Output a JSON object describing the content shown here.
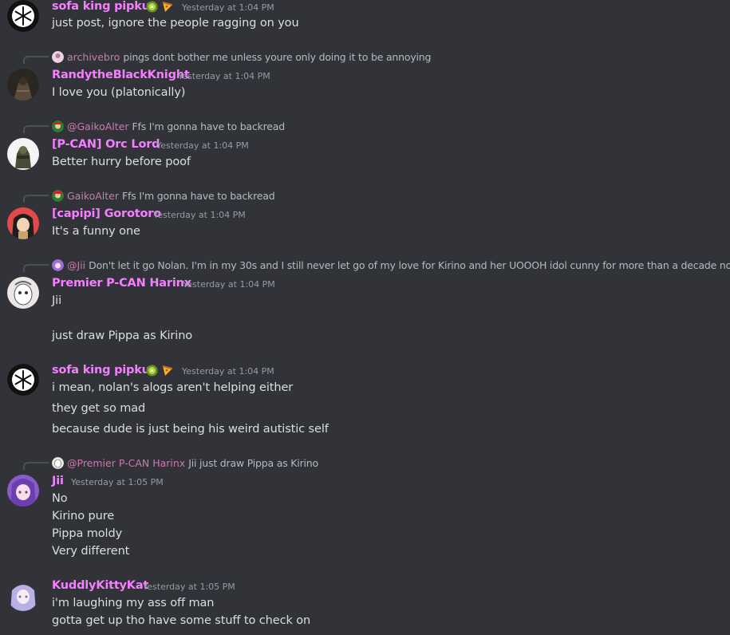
{
  "messages": [
    {
      "name": "sofa king pipkun",
      "timestamp": "Yesterday at 1:04 PM",
      "avatar_icon": "snowflake-avatar-icon",
      "badges": [
        "kiwi-icon",
        "pizza-icon"
      ],
      "lines": [
        "just post, ignore the people ragging on you"
      ]
    },
    {
      "reply_to": {
        "name": "archivebro",
        "text": "pings dont bother me unless youre only doing it to be annoying"
      },
      "name": "RandytheBlackKnight",
      "timestamp": "Yesterday at 1:04 PM",
      "avatar_icon": "knight-avatar-icon",
      "lines": [
        "I love you (platonically)"
      ]
    },
    {
      "reply_to": {
        "name": "@GaikoAlter",
        "text": "Ffs I'm gonna have to backread"
      },
      "name": "[P-CAN] Orc Lord",
      "timestamp": "Yesterday at 1:04 PM",
      "avatar_icon": "orc-avatar-icon",
      "lines": [
        "Better hurry before poof"
      ]
    },
    {
      "reply_to": {
        "name": "GaikoAlter",
        "text": "Ffs I'm gonna have to backread"
      },
      "name": "[capipi] Gorotoro",
      "timestamp": "Yesterday at 1:04 PM",
      "avatar_icon": "anime-girl-avatar-icon",
      "lines": [
        "It's a funny one"
      ]
    },
    {
      "reply_to": {
        "name": "@Jii",
        "text": "Don't let it go Nolan. I'm in my 30s and I still never let go of my love for Kirino and her UOOOH idol cunny for more than a decade now."
      },
      "name": "Premier P-CAN Harinx",
      "timestamp": "Yesterday at 1:04 PM",
      "avatar_icon": "sketch-face-avatar-icon",
      "lines": [
        "Jii",
        "",
        "just draw Pippa as Kirino"
      ]
    },
    {
      "name": "sofa king pipkun",
      "timestamp": "Yesterday at 1:04 PM",
      "avatar_icon": "snowflake-avatar-icon",
      "badges": [
        "kiwi-icon",
        "pizza-icon"
      ],
      "lines": [
        "i mean, nolan's alogs aren't helping either",
        "they get so mad",
        "because dude is just being his weird autistic self"
      ]
    },
    {
      "reply_to": {
        "name": "@Premier P-CAN Harinx",
        "text": "Jii just draw Pippa as Kirino"
      },
      "name": "Jii",
      "timestamp": "Yesterday at 1:05 PM",
      "avatar_icon": "purple-hair-avatar-icon",
      "lines": [
        "No",
        "Kirino pure",
        "Pippa moldy",
        "Very different"
      ]
    },
    {
      "name": "KuddlyKittyKat",
      "timestamp": "Yesterday at 1:05 PM",
      "avatar_icon": "lavender-hair-avatar-icon",
      "lines": [
        "i'm laughing my ass off man",
        "gotta get up tho have some stuff to check on"
      ]
    }
  ]
}
